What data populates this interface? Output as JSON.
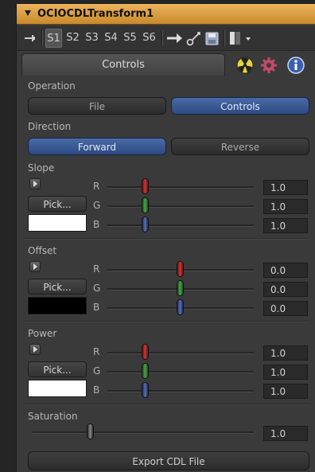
{
  "title": "OCIOCDLTransform1",
  "toolbar": {
    "slots": [
      "S1",
      "S2",
      "S3",
      "S4",
      "S5",
      "S6"
    ],
    "active_slot": "S1"
  },
  "tabs": {
    "controls": "Controls"
  },
  "operation": {
    "label": "Operation",
    "options": [
      "File",
      "Controls"
    ],
    "selected": "Controls"
  },
  "direction": {
    "label": "Direction",
    "options": [
      "Forward",
      "Reverse"
    ],
    "selected": "Forward"
  },
  "channels": [
    "R",
    "G",
    "B"
  ],
  "pick_label": "Pick...",
  "slope": {
    "label": "Slope",
    "color": "#ffffff",
    "r": "1.0",
    "g": "1.0",
    "b": "1.0"
  },
  "offset": {
    "label": "Offset",
    "color": "#000000",
    "r": "0.0",
    "g": "0.0",
    "b": "0.0"
  },
  "power": {
    "label": "Power",
    "color": "#ffffff",
    "r": "1.0",
    "g": "1.0",
    "b": "1.0"
  },
  "saturation": {
    "label": "Saturation",
    "value": "1.0"
  },
  "export_label": "Export CDL File",
  "colors": {
    "title_bar": "#d99a3c",
    "accent_blue": "#3b5b97"
  }
}
